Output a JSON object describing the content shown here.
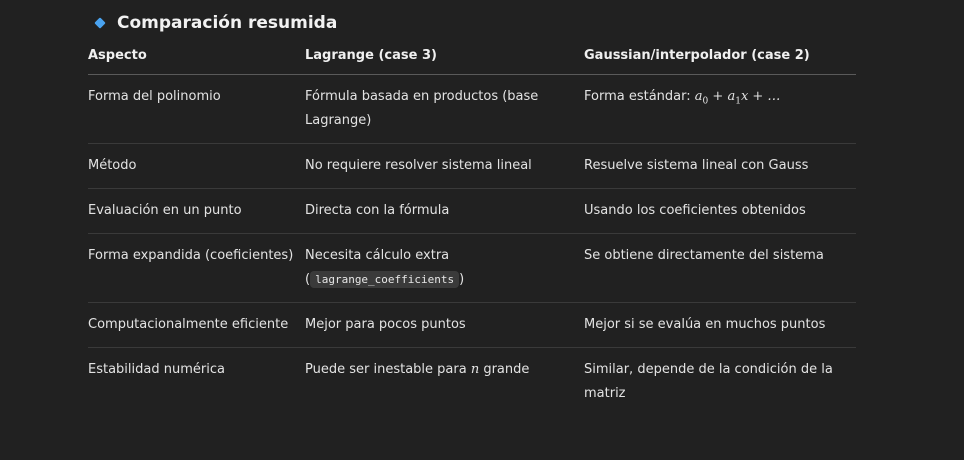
{
  "section": {
    "title": "Comparación resumida",
    "bullet_icon": "blue-diamond-icon",
    "bullet_color": "#4aa3f0"
  },
  "table": {
    "headers": [
      "Aspecto",
      "Lagrange (case 3)",
      "Gaussian/interpolador (case 2)"
    ],
    "rows": [
      {
        "aspect": "Forma del polinomio",
        "lagrange": "Fórmula basada en productos (base Lagrange)",
        "gauss_prefix": "Forma estándar: ",
        "gauss_math": "a0 + a1x + …"
      },
      {
        "aspect": "Método",
        "lagrange": "No requiere resolver sistema lineal",
        "gauss": "Resuelve sistema lineal con Gauss"
      },
      {
        "aspect": "Evaluación en un punto",
        "lagrange": "Directa con la fórmula",
        "gauss": "Usando los coeficientes obtenidos"
      },
      {
        "aspect": "Forma expandida (coeficientes)",
        "lagrange_text": "Necesita cálculo extra",
        "lagrange_code": "lagrange_coefficients",
        "gauss": "Se obtiene directamente del sistema"
      },
      {
        "aspect": "Computacionalmente eficiente",
        "lagrange": "Mejor para pocos puntos",
        "gauss": "Mejor si se evalúa en muchos puntos"
      },
      {
        "aspect": "Estabilidad numérica",
        "lagrange_prefix": "Puede ser inestable para ",
        "lagrange_math": "n",
        "lagrange_suffix": " grande",
        "gauss": "Similar, depende de la condición de la matriz"
      }
    ]
  }
}
